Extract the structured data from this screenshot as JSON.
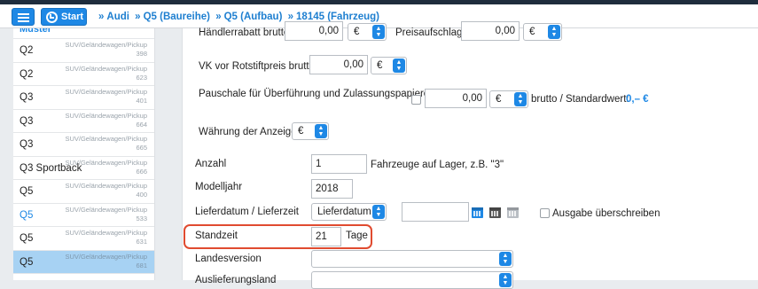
{
  "toolbar": {
    "menu_icon": "list-icon",
    "start_icon": "dashboard-icon",
    "start_label": "Start"
  },
  "breadcrumb": [
    "Audi",
    "Q5 (Baureihe)",
    "Q5 (Aufbau)",
    "18145 (Fahrzeug)"
  ],
  "breadcrumb_sep": "»",
  "sidebar": {
    "header": "Muster",
    "items": [
      {
        "name": "Q2",
        "category": "SUV/Geländewagen/Pickup",
        "count": "398",
        "highlight": false,
        "active": false
      },
      {
        "name": "Q2",
        "category": "SUV/Geländewagen/Pickup",
        "count": "623",
        "highlight": false,
        "active": false
      },
      {
        "name": "Q3",
        "category": "SUV/Geländewagen/Pickup",
        "count": "401",
        "highlight": false,
        "active": false
      },
      {
        "name": "Q3",
        "category": "SUV/Geländewagen/Pickup",
        "count": "664",
        "highlight": false,
        "active": false
      },
      {
        "name": "Q3",
        "category": "SUV/Geländewagen/Pickup",
        "count": "665",
        "highlight": false,
        "active": false
      },
      {
        "name": "Q3 Sportback",
        "category": "SUV/Geländewagen/Pickup",
        "count": "666",
        "highlight": false,
        "active": false
      },
      {
        "name": "Q5",
        "category": "SUV/Geländewagen/Pickup",
        "count": "400",
        "highlight": false,
        "active": false
      },
      {
        "name": "Q5",
        "category": "SUV/Geländewagen/Pickup",
        "count": "533",
        "highlight": true,
        "active": false
      },
      {
        "name": "Q5",
        "category": "SUV/Geländewagen/Pickup",
        "count": "631",
        "highlight": false,
        "active": false
      },
      {
        "name": "Q5",
        "category": "SUV/Geländewagen/Pickup",
        "count": "681",
        "highlight": false,
        "active": true
      }
    ]
  },
  "form": {
    "haendlerrabatt_label": "Händlerrabatt brutto",
    "haendlerrabatt_value": "0,00",
    "haendlerrabatt_currency": "€",
    "preisaufschlag_label": "Preisaufschlag",
    "preisaufschlag_value": "0,00",
    "preisaufschlag_currency": "€",
    "vk_label": "VK vor Rotstiftpreis brutto",
    "vk_value": "0,00",
    "vk_currency": "€",
    "pauschale_label": "Pauschale für Überführung und Zulassungspapiere",
    "pauschale_value": "0,00",
    "pauschale_currency": "€",
    "pauschale_suffix": "brutto  /  Standardwert:",
    "pauschale_standard": "0,– €",
    "waehrung_label": "Währung der Anzeige",
    "waehrung_value": "€",
    "anzahl_label": "Anzahl",
    "anzahl_value": "1",
    "anzahl_hint": "Fahrzeuge auf Lager, z.B. \"3\"",
    "modelljahr_label": "Modelljahr",
    "modelljahr_value": "2018",
    "lieferdatum_label": "Lieferdatum / Lieferzeit",
    "lieferdatum_select": "Lieferdatum",
    "lieferdatum_value": "",
    "ausgabe_label": "Ausgabe überschreiben",
    "standzeit_label": "Standzeit",
    "standzeit_value": "21",
    "standzeit_unit": "Tage",
    "landesversion_label": "Landesversion",
    "landesversion_value": "",
    "auslieferungsland_label": "Auslieferungsland",
    "auslieferungsland_value": ""
  },
  "colors": {
    "accent": "#1e88e5",
    "highlight_box": "#e04b30",
    "active_row": "#a7d2f3"
  }
}
